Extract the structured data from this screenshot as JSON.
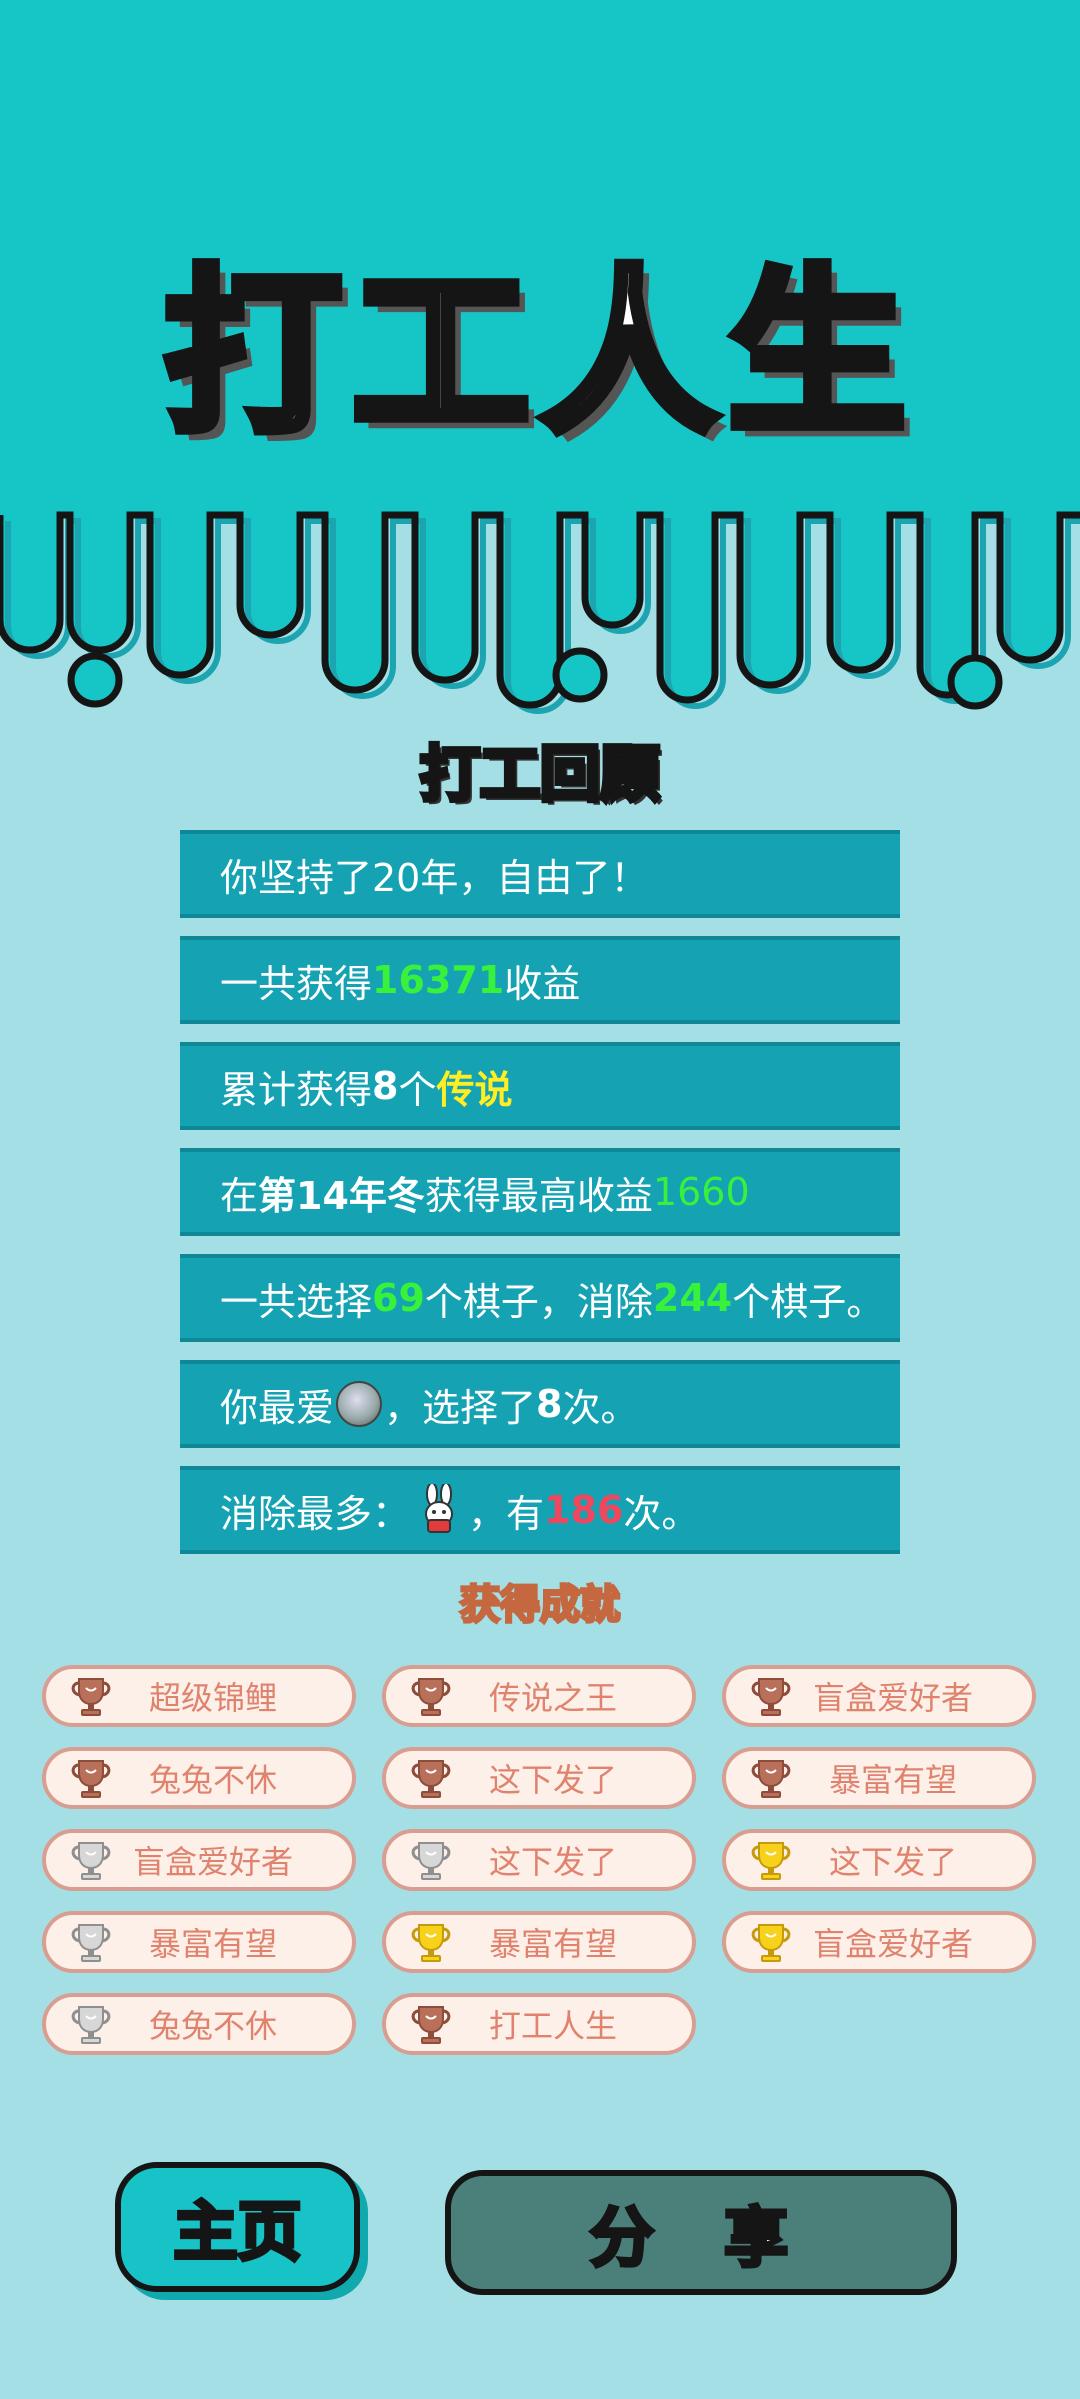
{
  "app_title": "打工人生",
  "review": {
    "title": "打工回顾",
    "rows": [
      {
        "a": "你坚持了20年，自由了！"
      },
      {
        "a": "一共获得",
        "b": "16371",
        "c": "收益"
      },
      {
        "a": "累计获得",
        "b": "8",
        "c": "个",
        "d": "传说"
      },
      {
        "a": "在 ",
        "b": "第14年冬",
        "c": " 获得最高收益",
        "d": "1660"
      },
      {
        "a": "一共选择",
        "b": "69",
        "c": "个棋子，消除",
        "d": "244",
        "e": "个棋子。"
      },
      {
        "a": "你最爱",
        "c": "，选择了",
        "d": "8",
        "e": "次。"
      },
      {
        "a": "消除最多：",
        "c": "，有",
        "d": "186",
        "e": "次。"
      }
    ]
  },
  "achievements": {
    "title": "获得成就",
    "items": [
      {
        "label": "超级锦鲤",
        "trophy": "bronze"
      },
      {
        "label": "传说之王",
        "trophy": "bronze"
      },
      {
        "label": "盲盒爱好者",
        "trophy": "bronze"
      },
      {
        "label": "兔兔不休",
        "trophy": "bronze"
      },
      {
        "label": "这下发了",
        "trophy": "bronze"
      },
      {
        "label": "暴富有望",
        "trophy": "bronze"
      },
      {
        "label": "盲盒爱好者",
        "trophy": "silver"
      },
      {
        "label": "这下发了",
        "trophy": "silver"
      },
      {
        "label": "这下发了",
        "trophy": "gold"
      },
      {
        "label": "暴富有望",
        "trophy": "silver"
      },
      {
        "label": "暴富有望",
        "trophy": "gold"
      },
      {
        "label": "盲盒爱好者",
        "trophy": "gold"
      },
      {
        "label": "兔兔不休",
        "trophy": "silver"
      },
      {
        "label": "打工人生",
        "trophy": "bronze"
      }
    ]
  },
  "buttons": {
    "home": "主页",
    "share": "分 享"
  },
  "colors": {
    "top_band": "#16c6c7",
    "background": "#a5dfe6",
    "row": "#15a3b3",
    "highlight_green": "#38f13b",
    "highlight_yellow": "#ffee22",
    "highlight_red": "#f0465e"
  }
}
